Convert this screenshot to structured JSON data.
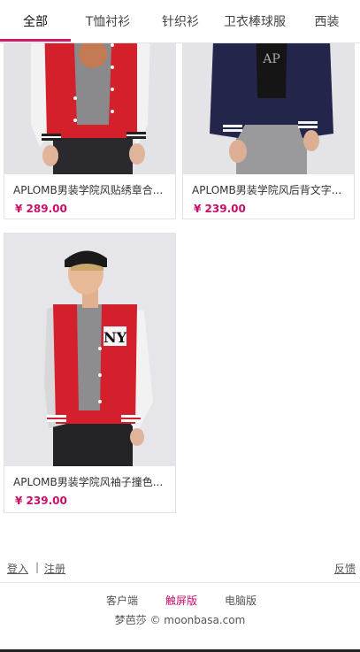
{
  "tabs": [
    {
      "label": "全部",
      "active": true
    },
    {
      "label": "T恤衬衫",
      "active": false
    },
    {
      "label": "针织衫",
      "active": false
    },
    {
      "label": "卫衣棒球服",
      "active": false
    },
    {
      "label": "西装",
      "active": false
    }
  ],
  "products": [
    {
      "name": "APLOMB男装学院风贴绣章合...",
      "price": "¥ 289.00"
    },
    {
      "name": "APLOMB男装学院风后背文字...",
      "price": "¥ 239.00"
    },
    {
      "name": "APLOMB男装学院风袖子撞色...",
      "price": "¥ 239.00"
    }
  ],
  "footer": {
    "login": "登入",
    "separator": "|",
    "register": "注册",
    "feedback": "反馈",
    "versions": [
      {
        "label": "客户端",
        "active": false
      },
      {
        "label": "触屏版",
        "active": true
      },
      {
        "label": "电脑版",
        "active": false
      }
    ],
    "copyright": "梦芭莎 © moonbasa.com"
  },
  "colors": {
    "accent": "#d6186a",
    "price": "#c8106a"
  }
}
